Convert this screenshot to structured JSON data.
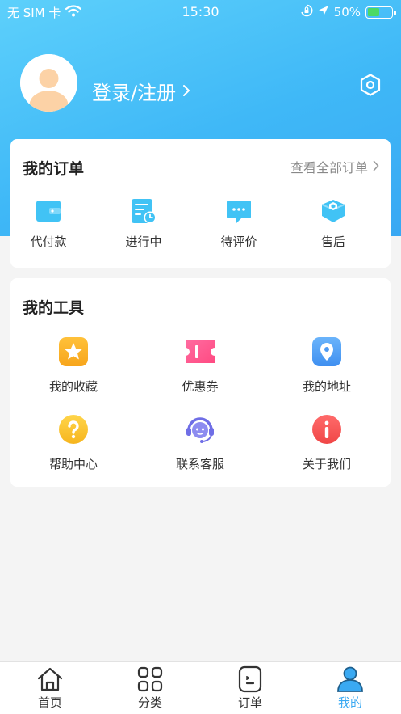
{
  "status_bar": {
    "carrier": "无 SIM 卡",
    "time": "15:30",
    "battery": "50%",
    "battery_level": 0.5,
    "icons": [
      "wifi-icon",
      "orientation-lock-icon",
      "location-arrow-icon",
      "battery-icon"
    ]
  },
  "profile": {
    "login_label": "登录/注册",
    "avatar_icon": "default-avatar-icon",
    "settings_icon": "settings-hexagon-icon"
  },
  "orders": {
    "title": "我的订单",
    "view_all": "查看全部订单",
    "items": [
      {
        "label": "代付款",
        "icon": "wallet-icon"
      },
      {
        "label": "进行中",
        "icon": "in-progress-icon"
      },
      {
        "label": "待评价",
        "icon": "review-chat-icon"
      },
      {
        "label": "售后",
        "icon": "after-sales-icon"
      }
    ]
  },
  "tools": {
    "title": "我的工具",
    "items": [
      {
        "label": "我的收藏",
        "icon": "star-favorite-icon"
      },
      {
        "label": "优惠券",
        "icon": "coupon-icon"
      },
      {
        "label": "我的地址",
        "icon": "location-pin-icon"
      },
      {
        "label": "帮助中心",
        "icon": "help-question-icon"
      },
      {
        "label": "联系客服",
        "icon": "customer-service-icon"
      },
      {
        "label": "关于我们",
        "icon": "info-icon"
      }
    ]
  },
  "tab_bar": {
    "items": [
      {
        "label": "首页",
        "icon": "home-icon"
      },
      {
        "label": "分类",
        "icon": "category-grid-icon"
      },
      {
        "label": "订单",
        "icon": "order-icon"
      },
      {
        "label": "我的",
        "icon": "profile-icon"
      }
    ],
    "active": "我的"
  },
  "colors": {
    "header_gradient_start": "#5dd0fb",
    "header_gradient_end": "#39a8f3",
    "accent": "#3aa9f2",
    "background": "#f4f4f4",
    "battery_fill": "#4cd964"
  }
}
